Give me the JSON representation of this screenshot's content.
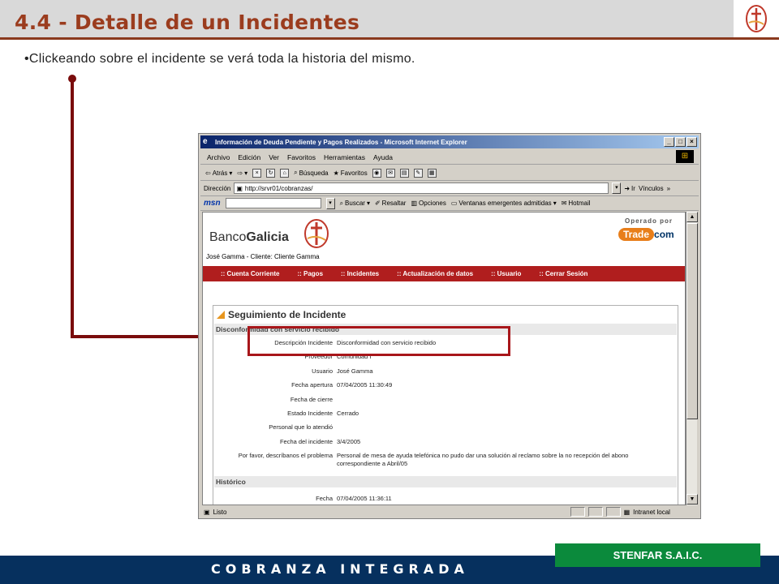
{
  "slide": {
    "title": "4.4 - Detalle de un Incidentes",
    "bullet": "•Clickeando sobre el incidente se verá toda la historia del mismo.",
    "footer": "COBRANZA INTEGRADA",
    "company": "STENFAR S.A.I.C."
  },
  "colors": {
    "title": "#9b3c1e",
    "footer_bg": "#06305e",
    "badge_bg": "#0b8a3c",
    "nav_bg": "#b01e1e",
    "connector": "#7a0c0c"
  },
  "browser": {
    "title": "Información de Deuda Pendiente y Pagos Realizados - Microsoft Internet Explorer",
    "menu": [
      "Archivo",
      "Edición",
      "Ver",
      "Favoritos",
      "Herramientas",
      "Ayuda"
    ],
    "toolbar": {
      "back": "Atrás",
      "search": "Búsqueda",
      "favorites": "Favoritos"
    },
    "address_label": "Dirección",
    "address_value": "http://srvr01/cobranzas/",
    "go": "Ir",
    "links": "Vínculos",
    "msn": {
      "logo": "msn",
      "buscar": "Buscar",
      "resaltar": "Resaltar",
      "opciones": "Opciones",
      "popups": "Ventanas emergentes admitidas",
      "hotmail": "Hotmail"
    },
    "status_left": "Listo",
    "status_zone": "Intranet local"
  },
  "bank": {
    "name_light": "Banco",
    "name_bold": "Galicia",
    "operado": "Operado por",
    "trade": "Trade",
    "com": "com",
    "user_line": "José Gamma - Cliente: Cliente Gamma",
    "nav": [
      ":: Cuenta Corriente",
      ":: Pagos",
      ":: Incidentes",
      ":: Actualización de datos",
      ":: Usuario",
      ":: Cerrar Sesión"
    ]
  },
  "panel": {
    "title": "Seguimiento de Incidente",
    "section1": "Disconformidad con servicio recibido",
    "rows": [
      {
        "label": "Descripción Incidente",
        "value": "Disconformidad con servicio recibido"
      },
      {
        "label": "Proveedor",
        "value": "Comunidad I"
      },
      {
        "label": "Usuario",
        "value": "José Gamma"
      },
      {
        "label": "Fecha apertura",
        "value": "07/04/2005 11:30:49"
      },
      {
        "label": "Fecha de cierre",
        "value": ""
      },
      {
        "label": "Estado Incidente",
        "value": "Cerrado"
      },
      {
        "label": "Personal que lo atendió",
        "value": ""
      },
      {
        "label": "Fecha del incidente",
        "value": "3/4/2005"
      },
      {
        "label": "Por favor, descríbanos el problema",
        "value": "Personal de mesa de ayuda telefónica no pudo dar una solución al reclamo sobre la no recepción del abono correspondiente a Abril/05"
      }
    ],
    "section2": "Histórico",
    "history_rows": [
      {
        "label": "Fecha",
        "value": "07/04/2005 11:36:11"
      }
    ]
  }
}
